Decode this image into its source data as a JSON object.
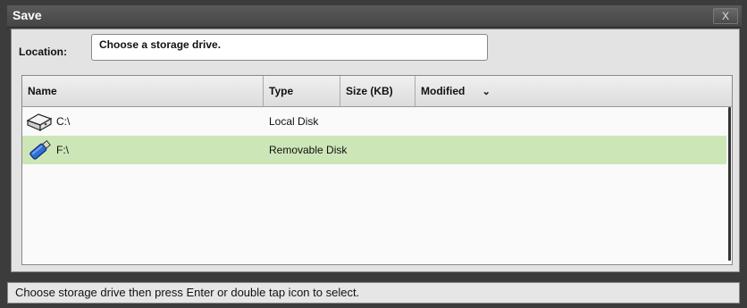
{
  "window": {
    "title": "Save",
    "close_label": "X"
  },
  "location": {
    "label": "Location:",
    "value": "Choose a storage drive."
  },
  "columns": {
    "name": "Name",
    "type": "Type",
    "size": "Size (KB)",
    "modified": "Modified"
  },
  "drives": [
    {
      "name": "C:\\",
      "type": "Local Disk",
      "icon": "hard-drive-icon",
      "selected": false
    },
    {
      "name": "F:\\",
      "type": "Removable Disk",
      "icon": "usb-drive-icon",
      "selected": true
    }
  ],
  "status": {
    "text": "Choose storage drive then press Enter or double tap icon to select."
  },
  "colors": {
    "selected_row": "#cde6b8",
    "title_bar": "#4a4a4a"
  }
}
